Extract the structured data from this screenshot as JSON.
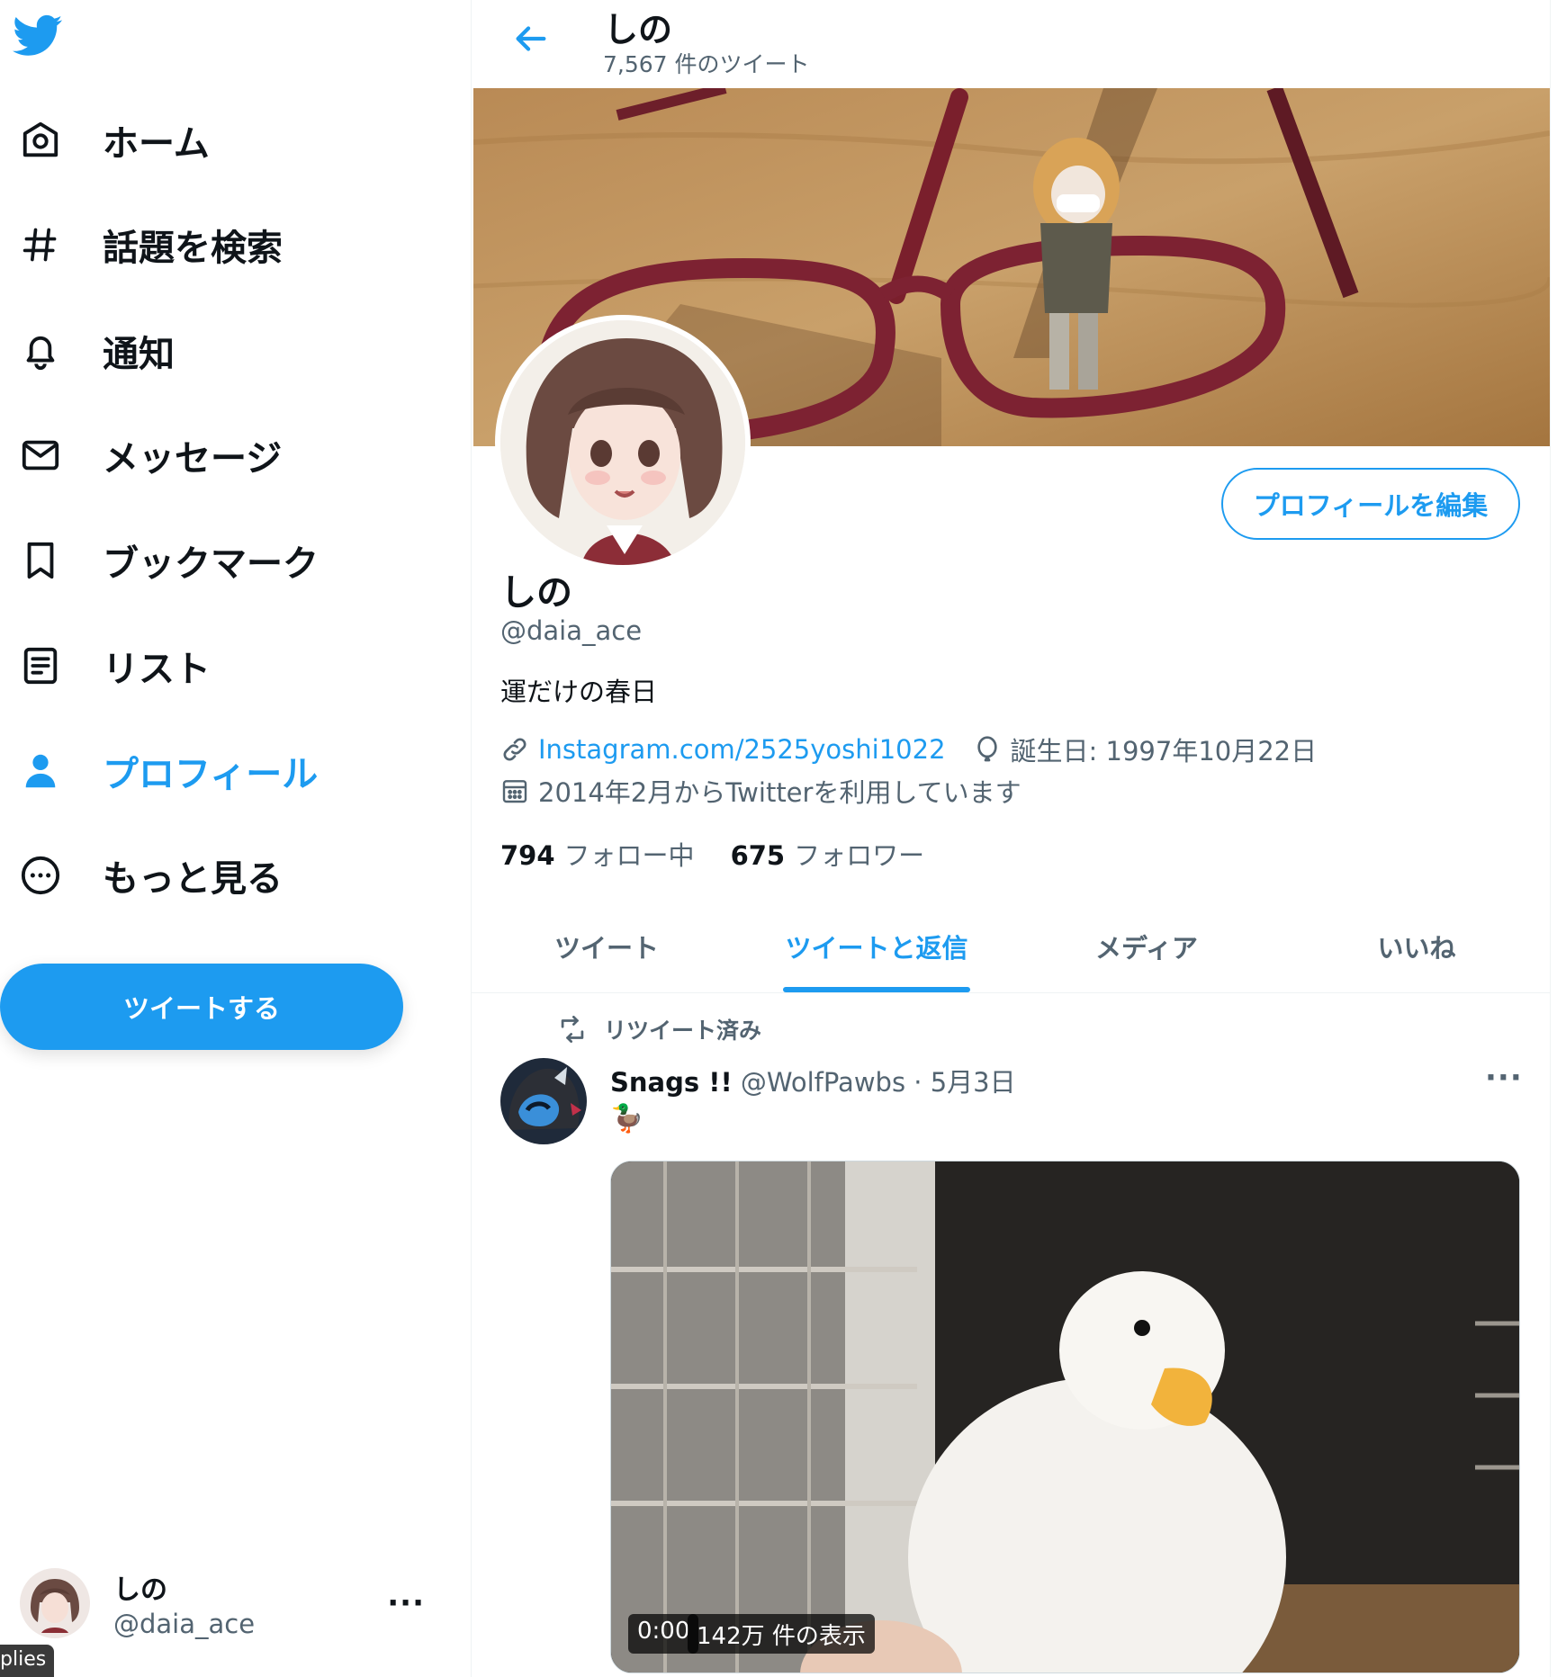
{
  "nav": {
    "items": [
      {
        "label": "ホーム",
        "icon": "home-icon"
      },
      {
        "label": "話題を検索",
        "icon": "hashtag-icon"
      },
      {
        "label": "通知",
        "icon": "bell-icon"
      },
      {
        "label": "メッセージ",
        "icon": "mail-icon"
      },
      {
        "label": "ブックマーク",
        "icon": "bookmark-icon"
      },
      {
        "label": "リスト",
        "icon": "list-icon"
      },
      {
        "label": "プロフィール",
        "icon": "person-icon"
      },
      {
        "label": "もっと見る",
        "icon": "more-circle-icon"
      }
    ],
    "tweet_button": "ツイートする"
  },
  "account": {
    "name": "しの",
    "handle": "@daia_ace",
    "more": "···"
  },
  "cookie_tab": "plies",
  "header": {
    "title": "しの",
    "tweet_count": "7,567 件のツイート"
  },
  "profile": {
    "name": "しの",
    "handle": "@daia_ace",
    "bio": "運だけの春日",
    "link": "Instagram.com/2525yoshi1022",
    "birthday": "誕生日: 1997年10月22日",
    "joined": "2014年2月からTwitterを利用しています",
    "following_count": "794",
    "following_label": "フォロー中",
    "followers_count": "675",
    "followers_label": "フォロワー",
    "edit_button": "プロフィールを編集"
  },
  "tabs": [
    {
      "label": "ツイート",
      "active": false
    },
    {
      "label": "ツイートと返信",
      "active": true
    },
    {
      "label": "メディア",
      "active": false
    },
    {
      "label": "いいね",
      "active": false
    }
  ],
  "tweet": {
    "retweet_label": "リツイート済み",
    "author_name": "Snags !!",
    "author_handle": "@WolfPawbs",
    "separator": "·",
    "date": "5月3日",
    "more": "···",
    "text": "🦆",
    "video_time": "0:00",
    "video_views": "142万 件の表示"
  },
  "colors": {
    "accent": "#1d9bf0",
    "text": "#0f1419",
    "secondary": "#536471"
  }
}
